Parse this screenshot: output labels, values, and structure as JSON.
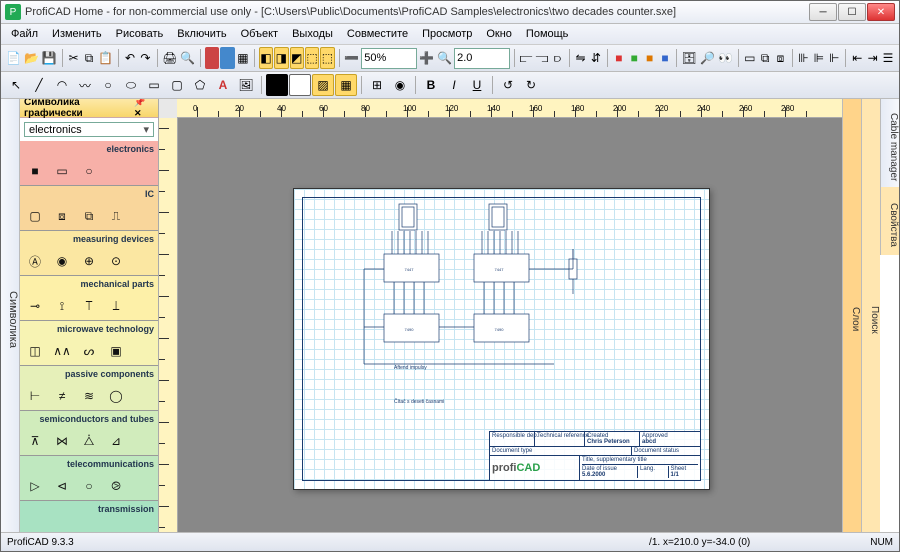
{
  "window": {
    "title": "ProfiCAD Home - for non-commercial use only - [C:\\Users\\Public\\Documents\\ProfiCAD Samples\\electronics\\two decades counter.sxe]"
  },
  "menu": [
    "Файл",
    "Изменить",
    "Рисовать",
    "Включить",
    "Объект",
    "Выходы",
    "Совместите",
    "Просмотр",
    "Окно",
    "Помощь"
  ],
  "zoom1": "50%",
  "zoom2": "2.0",
  "leftTab": "Символика",
  "palette": {
    "title": "Символика графически",
    "combo": "electronics",
    "cats": [
      {
        "name": "electronics",
        "syms": [
          "■",
          "▭",
          "○"
        ]
      },
      {
        "name": "IC",
        "syms": [
          "▢",
          "⧈",
          "⧉",
          "⎍"
        ]
      },
      {
        "name": "measuring devices",
        "syms": [
          "Ⓐ",
          "◉",
          "⊕",
          "⊙"
        ]
      },
      {
        "name": "mechanical parts",
        "syms": [
          "⊸",
          "⟟",
          "⟙",
          "⟘"
        ]
      },
      {
        "name": "microwave technology",
        "syms": [
          "◫",
          "∧∧",
          "ᔕ",
          "▣"
        ]
      },
      {
        "name": "passive components",
        "syms": [
          "⊢",
          "≠",
          "≋",
          "◯"
        ]
      },
      {
        "name": "semiconductors and tubes",
        "syms": [
          "⊼",
          "⋈",
          "⧊",
          "⊿"
        ]
      },
      {
        "name": "telecommunications",
        "syms": [
          "▷",
          "⊲",
          "○",
          "⧁"
        ]
      },
      {
        "name": "transmission",
        "syms": []
      }
    ]
  },
  "rightTabs": [
    "Слои",
    "Поиск",
    "Cable manager",
    "Свойства"
  ],
  "titleblock": {
    "r1": [
      "Responsible dep.",
      "Technical reference",
      "Created",
      "",
      "Approved"
    ],
    "r1v": [
      "",
      "",
      "Chris Peterson",
      "",
      "abcd"
    ],
    "r2": [
      "Document type",
      "",
      "Document status"
    ],
    "r3": [
      "Title, supplementary title"
    ],
    "r4": [
      "Date of issue",
      "Lang.",
      "Sheet"
    ],
    "r4v": [
      "5.6.2000",
      "",
      "1/1"
    ]
  },
  "annot1": "Aftend impulsy",
  "annot2": "Čítač s deseti časnami",
  "status": {
    "version": "ProfiCAD 9.3.3",
    "coords": "/1.  x=210.0  y=-34.0 (0)",
    "num": "NUM"
  },
  "rulerMajors": [
    0,
    20,
    40,
    60,
    80,
    100,
    120,
    140,
    160,
    180,
    200,
    220,
    240,
    260,
    280
  ]
}
